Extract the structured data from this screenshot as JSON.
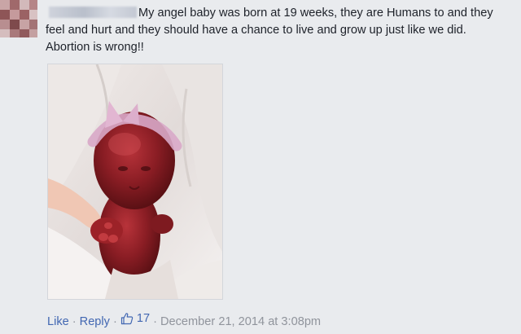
{
  "comment": {
    "text": "My angel baby was born at 19 weeks, they are Humans to and they feel and hurt and they should have a chance to live and grow up just like we did. Abortion is wrong!!",
    "photo_icon": "newborn-photo",
    "actions": {
      "like_label": "Like",
      "reply_label": "Reply",
      "separator": "·",
      "like_count": "17",
      "like_icon": "thumbs-up-icon",
      "timestamp": "December 21, 2014 at 3:08pm"
    }
  },
  "colors": {
    "background": "#e9ebee",
    "link": "#4267b2",
    "meta": "#90949c",
    "text": "#1d2129"
  }
}
